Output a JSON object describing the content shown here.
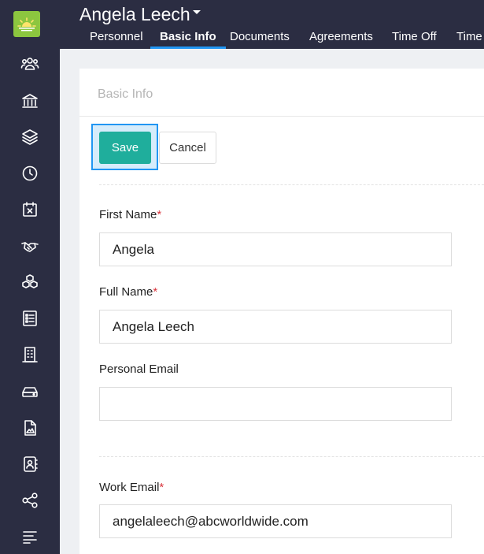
{
  "header": {
    "person_name": "Angela Leech",
    "tabs": [
      {
        "label": "Personnel",
        "active": false
      },
      {
        "label": "Basic Info",
        "active": true
      },
      {
        "label": "Documents",
        "active": false
      },
      {
        "label": "Agreements",
        "active": false
      },
      {
        "label": "Time Off",
        "active": false
      },
      {
        "label": "Time",
        "active": false
      }
    ]
  },
  "sidebar": {
    "logo_icon": "sunrise-logo-icon",
    "items": [
      "users-icon",
      "bank-icon",
      "layers-icon",
      "clock-icon",
      "calendar-x-icon",
      "handshake-icon",
      "cubes-icon",
      "checklist-icon",
      "building-icon",
      "drive-icon",
      "file-image-icon",
      "contact-book-icon",
      "share-icon",
      "menu-icon"
    ]
  },
  "card": {
    "title": "Basic Info",
    "save_label": "Save",
    "cancel_label": "Cancel",
    "fields": {
      "first_name": {
        "label": "First Name",
        "required_mark": "*",
        "value": "Angela"
      },
      "full_name": {
        "label": "Full Name",
        "required_mark": "*",
        "value": "Angela Leech"
      },
      "personal_email": {
        "label": "Personal Email",
        "value": ""
      },
      "work_email": {
        "label": "Work Email",
        "required_mark": "*",
        "value": "angelaleech@abcworldwide.com"
      }
    }
  },
  "colors": {
    "sidebar_bg": "#2b2d42",
    "accent_blue": "#2196f3",
    "save_teal": "#1fae9c",
    "required_red": "#d9363e",
    "logo_green": "#8cc63f"
  }
}
